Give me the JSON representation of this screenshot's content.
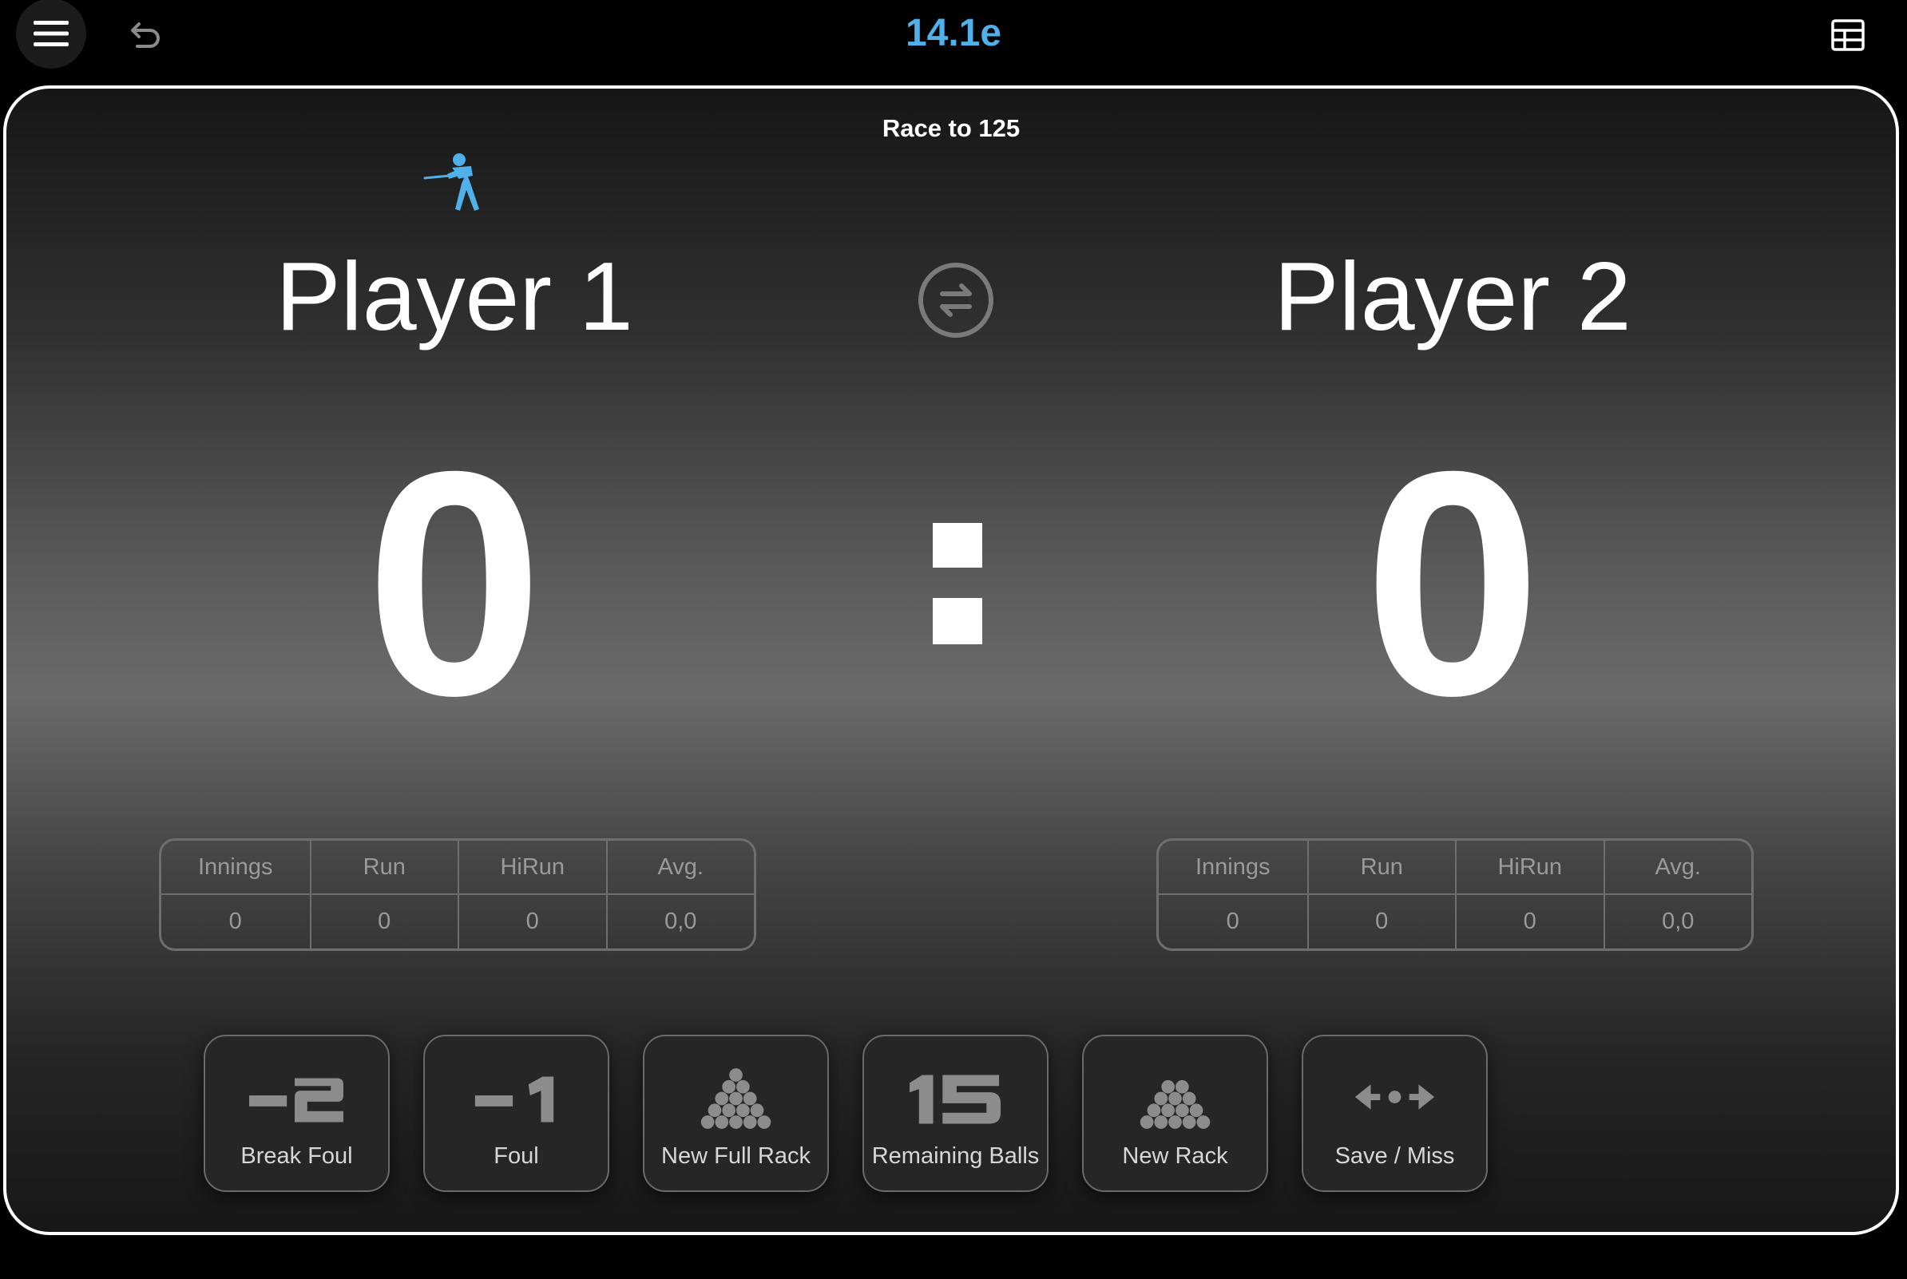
{
  "app": {
    "title": "14.1e"
  },
  "toolbar": {
    "menu_icon": "hamburger-menu-icon",
    "undo_icon": "undo-icon",
    "table_icon": "table-grid-icon"
  },
  "match": {
    "race_text": "Race to 125",
    "active_player": 1,
    "active_icon": "pool-player-icon",
    "swap_icon": "swap-players-icon",
    "separator": ":"
  },
  "players": [
    {
      "name": "Player 1",
      "score": "0",
      "stats": {
        "innings": "0",
        "run": "0",
        "hirun": "0",
        "avg": "0,0"
      }
    },
    {
      "name": "Player 2",
      "score": "0",
      "stats": {
        "innings": "0",
        "run": "0",
        "hirun": "0",
        "avg": "0,0"
      }
    }
  ],
  "stats_headers": {
    "innings": "Innings",
    "run": "Run",
    "hirun": "HiRun",
    "avg": "Avg."
  },
  "actions": [
    {
      "label": "Break Foul",
      "icon": "minus-two-icon"
    },
    {
      "label": "Foul",
      "icon": "minus-one-icon"
    },
    {
      "label": "New Full Rack",
      "icon": "full-rack-triangle-icon"
    },
    {
      "label": "Remaining Balls",
      "icon": "fifteen-icon"
    },
    {
      "label": "New Rack",
      "icon": "rack-triangle-icon"
    },
    {
      "label": "Save / Miss",
      "icon": "save-miss-arrows-icon"
    }
  ],
  "colors": {
    "accent": "#4fb0ea",
    "panel_border": "#ffffff",
    "text_primary": "#ffffff",
    "text_secondary": "#9a9a9a",
    "icon_gray": "#8c8c8c"
  }
}
